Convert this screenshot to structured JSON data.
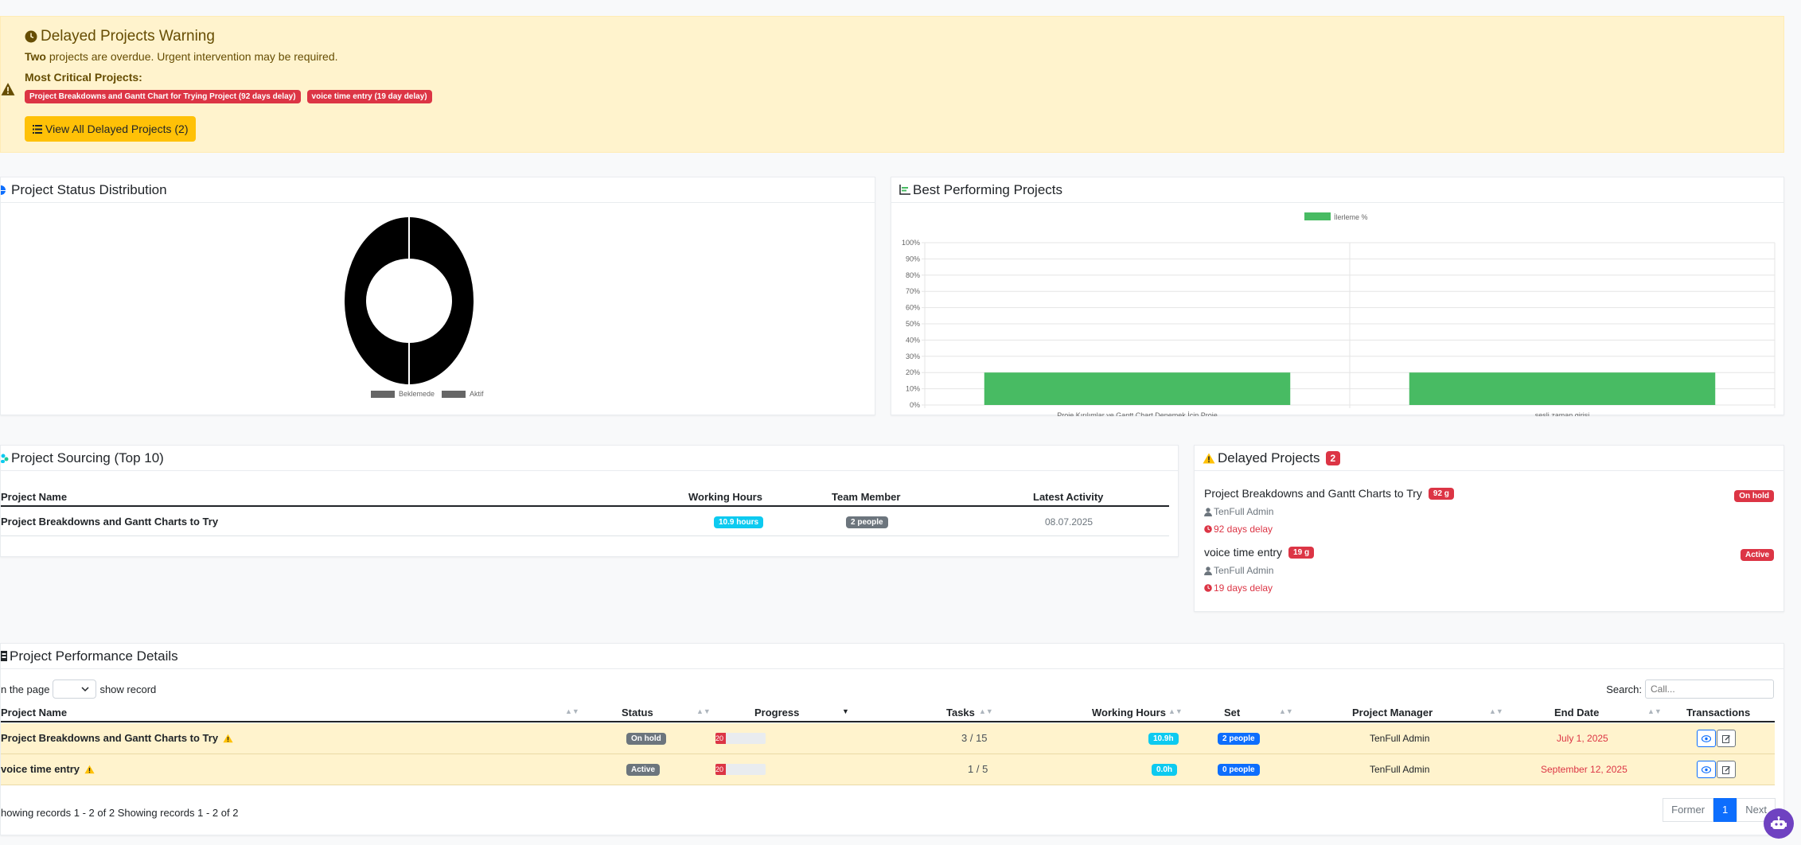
{
  "warning": {
    "title": "Delayed Projects Warning",
    "count_word": "Two",
    "text": " projects are overdue. Urgent intervention may be required.",
    "critical_label": "Most Critical Projects:",
    "critical": [
      "Project Breakdowns and Gantt Chart for Trying Project (92 days delay)",
      "voice time entry (19 day delay)"
    ],
    "button": "View All Delayed Projects (2)"
  },
  "status_chart": {
    "title": "Project Status Distribution",
    "legend": [
      "Beklemede",
      "Aktif"
    ]
  },
  "best_chart": {
    "title": "Best Performing Projects"
  },
  "chart_data": {
    "type": "bar",
    "categories": [
      "Proje Kırılımlar ve Gantt Chart Denemek İçin Proje",
      "sesli zaman girişi"
    ],
    "series": [
      {
        "name": "İlerleme %",
        "values": [
          20,
          20
        ],
        "color": "#48bb63"
      }
    ],
    "ylim": [
      0,
      100
    ],
    "yticks": [
      "0%",
      "10%",
      "20%",
      "30%",
      "40%",
      "50%",
      "60%",
      "70%",
      "80%",
      "90%",
      "100%"
    ],
    "grid": true,
    "legend": "top"
  },
  "sourcing": {
    "title": "Project Sourcing (Top 10)",
    "columns": [
      "Project Name",
      "Working Hours",
      "Team Member",
      "Latest Activity"
    ],
    "rows": [
      {
        "name": "Project Breakdowns and Gantt Charts to Try",
        "hours": "10.9 hours",
        "team": "2 people",
        "activity": "08.07.2025"
      }
    ]
  },
  "delayed": {
    "title": "Delayed Projects",
    "count": "2",
    "items": [
      {
        "name": "Project Breakdowns and Gantt Charts to Try",
        "badge": "92 g",
        "user": "TenFull Admin",
        "delay": "92 days delay",
        "status": "On hold"
      },
      {
        "name": "voice time entry",
        "badge": "19 g",
        "user": "TenFull Admin",
        "delay": "19 days delay",
        "status": "Active"
      }
    ]
  },
  "perf": {
    "title": "Project Performance Details",
    "on_page": "n the page",
    "show_record": "show record",
    "search_label": "Search:",
    "search_placeholder": "Call...",
    "columns": [
      "Project Name",
      "Status",
      "Progress",
      "Tasks",
      "Working Hours",
      "Set",
      "Project Manager",
      "End Date",
      "Transactions"
    ],
    "rows": [
      {
        "name": "Project Breakdowns and Gantt Charts to Try",
        "status": "On hold",
        "progress_label": "20",
        "progress": 20,
        "tasks": "3 / 15",
        "hours": "10.9h",
        "set": "2 people",
        "manager": "TenFull Admin",
        "end": "July 1, 2025"
      },
      {
        "name": "voice time entry",
        "status": "Active",
        "progress_label": "20",
        "progress": 20,
        "tasks": "1 / 5",
        "hours": "0.0h",
        "set": "0 people",
        "manager": "TenFull Admin",
        "end": "September 12, 2025"
      }
    ],
    "footer": "howing records 1 - 2 of 2 Showing records 1 - 2 of 2",
    "pager": {
      "prev": "Former",
      "page": "1",
      "next": "Next"
    }
  },
  "colors": {
    "warning_bg": "#fff3cd",
    "danger": "#dc3545",
    "success": "#48bb63",
    "primary": "#0d6efd",
    "info": "#0dcaf0"
  }
}
